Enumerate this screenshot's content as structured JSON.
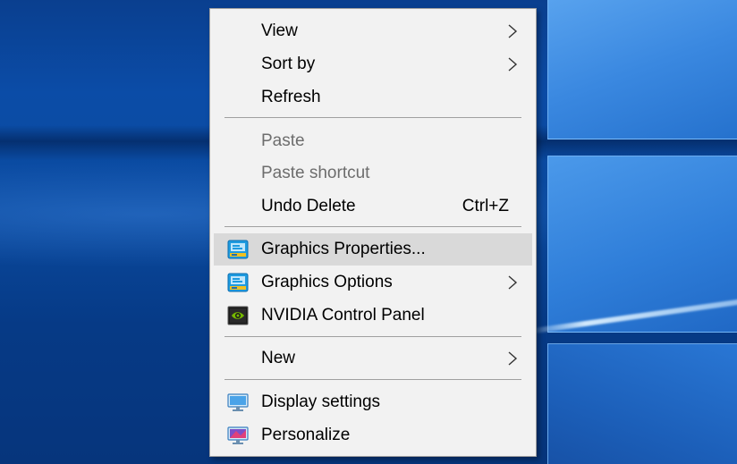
{
  "desktop": {
    "background_color": "#0a4a9f"
  },
  "context_menu": {
    "background_color": "#f2f2f2",
    "highlight_color": "#d9d9d9",
    "disabled_color": "#6d6d6d",
    "items": [
      {
        "label": "View",
        "has_submenu": true,
        "enabled": true
      },
      {
        "label": "Sort by",
        "has_submenu": true,
        "enabled": true
      },
      {
        "label": "Refresh",
        "enabled": true
      },
      {
        "label": "Paste",
        "enabled": false
      },
      {
        "label": "Paste shortcut",
        "enabled": false
      },
      {
        "label": "Undo Delete",
        "shortcut": "Ctrl+Z",
        "enabled": true
      },
      {
        "label": "Graphics Properties...",
        "icon": "intel-graphics-icon",
        "enabled": true,
        "highlighted": true
      },
      {
        "label": "Graphics Options",
        "icon": "intel-graphics-icon",
        "has_submenu": true,
        "enabled": true
      },
      {
        "label": "NVIDIA Control Panel",
        "icon": "nvidia-icon",
        "enabled": true
      },
      {
        "label": "New",
        "has_submenu": true,
        "enabled": true
      },
      {
        "label": "Display settings",
        "icon": "display-settings-icon",
        "enabled": true
      },
      {
        "label": "Personalize",
        "icon": "personalize-icon",
        "enabled": true
      }
    ]
  }
}
